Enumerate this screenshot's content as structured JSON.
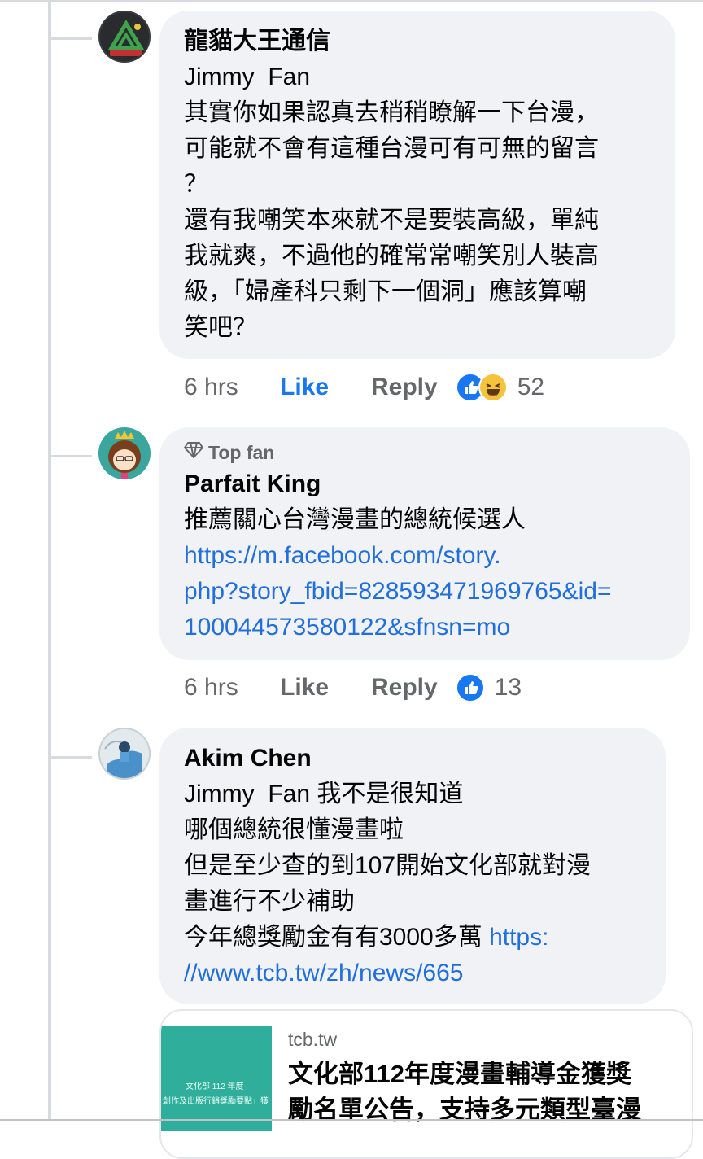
{
  "comments": [
    {
      "author": "龍貓大王通信",
      "lines": [
        {
          "text": "Jimmy  Fan"
        },
        {
          "text": "其實你如果認真去稍稍瞭解一下台漫，"
        },
        {
          "text": "可能就不會有這種台漫可有可無的留言"
        },
        {
          "text": "？"
        },
        {
          "text": "還有我嘲笑本來就不是要裝高級，單純"
        },
        {
          "text": "我就爽，不過他的確常常嘲笑別人裝高"
        },
        {
          "text": "級，「婦產科只剩下一個洞」應該算嘲"
        },
        {
          "text": "笑吧？"
        }
      ],
      "time": "6 hrs",
      "like_label": "Like",
      "reply_label": "Reply",
      "reaction_count": "52",
      "reactions": [
        "like-icon",
        "haha-icon"
      ]
    },
    {
      "badge": "Top fan",
      "author": "Parfait King",
      "lines": [
        {
          "text": "推薦關心台灣漫畫的總統候選人"
        },
        {
          "text": "https://m.facebook.com/story."
        },
        {
          "text": "php?story_fbid=828593471969765&id="
        },
        {
          "text": "100044573580122&sfnsn=mo"
        }
      ],
      "time": "6 hrs",
      "like_label": "Like",
      "reply_label": "Reply",
      "reaction_count": "13",
      "reactions": [
        "like-icon"
      ]
    },
    {
      "author": "Akim Chen",
      "lines": [
        {
          "text": "Jimmy  Fan 我不是很知道"
        },
        {
          "text": "哪個總統很懂漫畫啦"
        },
        {
          "text": "但是至少查的到107開始文化部就對漫"
        },
        {
          "text": "畫進行不少補助"
        },
        {
          "text": "今年總獎勵金有有3000多萬 ",
          "link": "https:"
        },
        {
          "text": "",
          "link": "//www.tcb.tw/zh/news/665"
        }
      ]
    }
  ],
  "link_preview": {
    "domain": "tcb.tw",
    "title_lines": [
      "文化部112年度漫畫輔導金獲獎",
      "勵名單公告，支持多元類型臺漫"
    ],
    "image_text": [
      "文化部 112 年度",
      "創作及出版行銷獎勵要點」獲"
    ]
  },
  "colors": {
    "link": "#216fdb",
    "like_active": "#1877f2",
    "bubble": "#f0f2f5"
  }
}
